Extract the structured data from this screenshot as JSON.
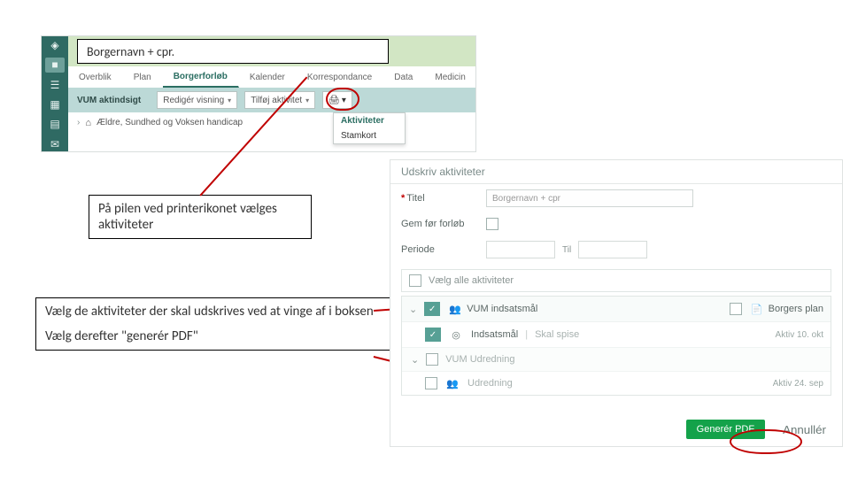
{
  "callout_borger": "Borgernavn + cpr.",
  "note_print_arrow": "På pilen ved printerikonet vælges aktiviteter",
  "note_select_activities": "Vælg de aktiviteter der skal udskrives ved at vinge af i boksen",
  "note_generate": "Vælg derefter \"generér PDF\"",
  "tabs": [
    "Overblik",
    "Plan",
    "Borgerforløb",
    "Kalender",
    "Korrespondance",
    "Data",
    "Medicin"
  ],
  "tabs_active_index": 2,
  "toolbar": {
    "title": "VUM aktindsigt",
    "edit_view": "Redigér visning",
    "add_activity": "Tilføj aktivitet"
  },
  "print_menu": {
    "item_active": "Aktiviteter",
    "item_other": "Stamkort"
  },
  "tree_item": "Ældre, Sundhed og Voksen handicap",
  "panel": {
    "title": "Udskriv aktiviteter",
    "titel_label": "Titel",
    "titel_value": "Borgernavn + cpr",
    "gemfor_label": "Gem før forløb",
    "periode_label": "Periode",
    "periode_to": "Til",
    "select_all": "Vælg alle aktiviteter",
    "header_vum": "VUM indsatsmål",
    "header_borger": "Borgers plan",
    "rows": [
      {
        "name": "Indsatsmål",
        "extra": "Skal spise",
        "meta": "Aktiv 10. okt"
      },
      {
        "name": "VUM Udredning",
        "extra": "",
        "meta": ""
      },
      {
        "name": "Udredning",
        "extra": "",
        "meta": "Aktiv 24. sep"
      }
    ]
  },
  "footer": {
    "generate": "Generér PDF",
    "cancel": "Annullér"
  }
}
